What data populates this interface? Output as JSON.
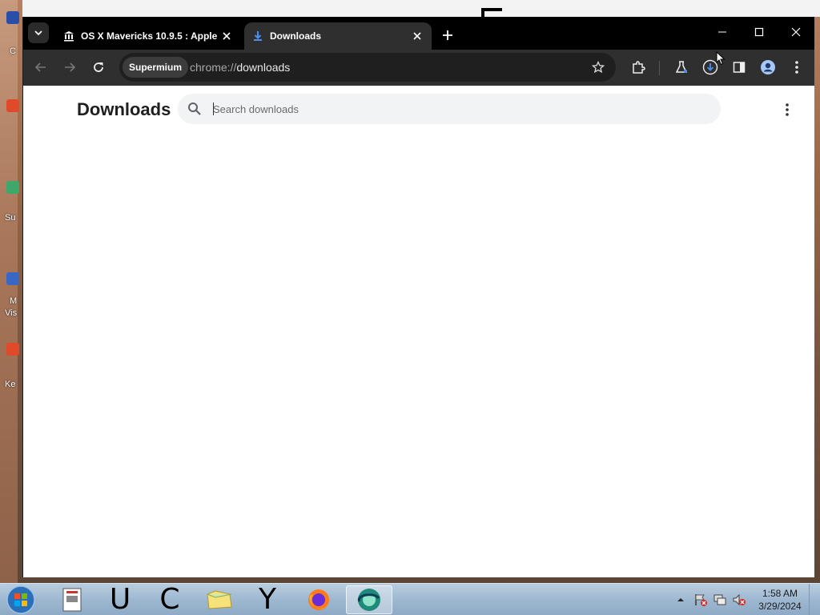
{
  "desktop": {
    "icon_labels": [
      "C",
      "Su",
      "M",
      "Vis",
      "Ke"
    ]
  },
  "window": {
    "tabs": [
      {
        "title": "OS X Mavericks 10.9.5 : Apple",
        "icon": "museum-icon",
        "active": false
      },
      {
        "title": "Downloads",
        "icon": "download-icon",
        "active": true
      }
    ],
    "controls": {
      "minimize": "minimize-icon",
      "maximize": "maximize-icon",
      "close": "close-icon"
    }
  },
  "toolbar": {
    "omnibox_chip": "Supermium",
    "url_scheme": "chrome://",
    "url_host": "downloads"
  },
  "page": {
    "title": "Downloads",
    "search_placeholder": "Search downloads"
  },
  "taskbar": {
    "letters": [
      "U",
      "C",
      "Y"
    ],
    "time": "1:58 AM",
    "date": "3/29/2024"
  },
  "colors": {
    "tab_strip": "#000000",
    "toolbar": "#2f2f2f",
    "omnibox": "#1f1f1f",
    "download_accent": "#1a73e8",
    "search_bg": "#f1f3f4"
  }
}
